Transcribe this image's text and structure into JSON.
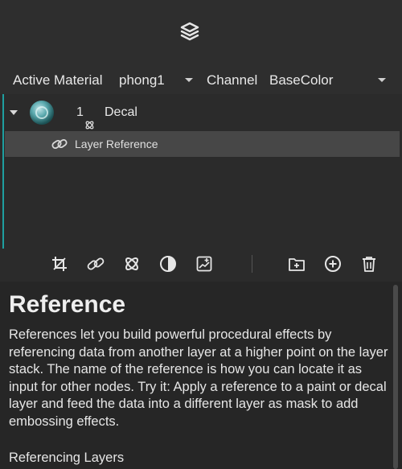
{
  "header": {
    "icon": "layers-stack-icon"
  },
  "material_row": {
    "active_material_label": "Active Material",
    "active_material_value": "phong1",
    "channel_label": "Channel",
    "channel_value": "BaseColor"
  },
  "layers": {
    "accent_color": "#1e9fa0",
    "items": [
      {
        "index": "1",
        "name": "Decal",
        "icon": "decal-icon",
        "children": [
          {
            "label": "Layer Reference",
            "icon": "link-icon"
          }
        ]
      }
    ]
  },
  "toolbar": {
    "icons": [
      "crop-icon",
      "link-icon",
      "decal-icon",
      "contrast-icon",
      "image-add-icon",
      "folder-add-icon",
      "add-circle-icon",
      "trash-icon"
    ]
  },
  "help": {
    "title": "Reference",
    "body": "References let you build powerful procedural effects by referencing data from another layer at a higher point on the layer stack. The name of the reference is how you can locate it as input for other nodes. Try it: Apply a reference to a paint or decal layer and feed the data into a different layer as mask to add embossing effects.",
    "subheading": "Referencing Layers"
  }
}
